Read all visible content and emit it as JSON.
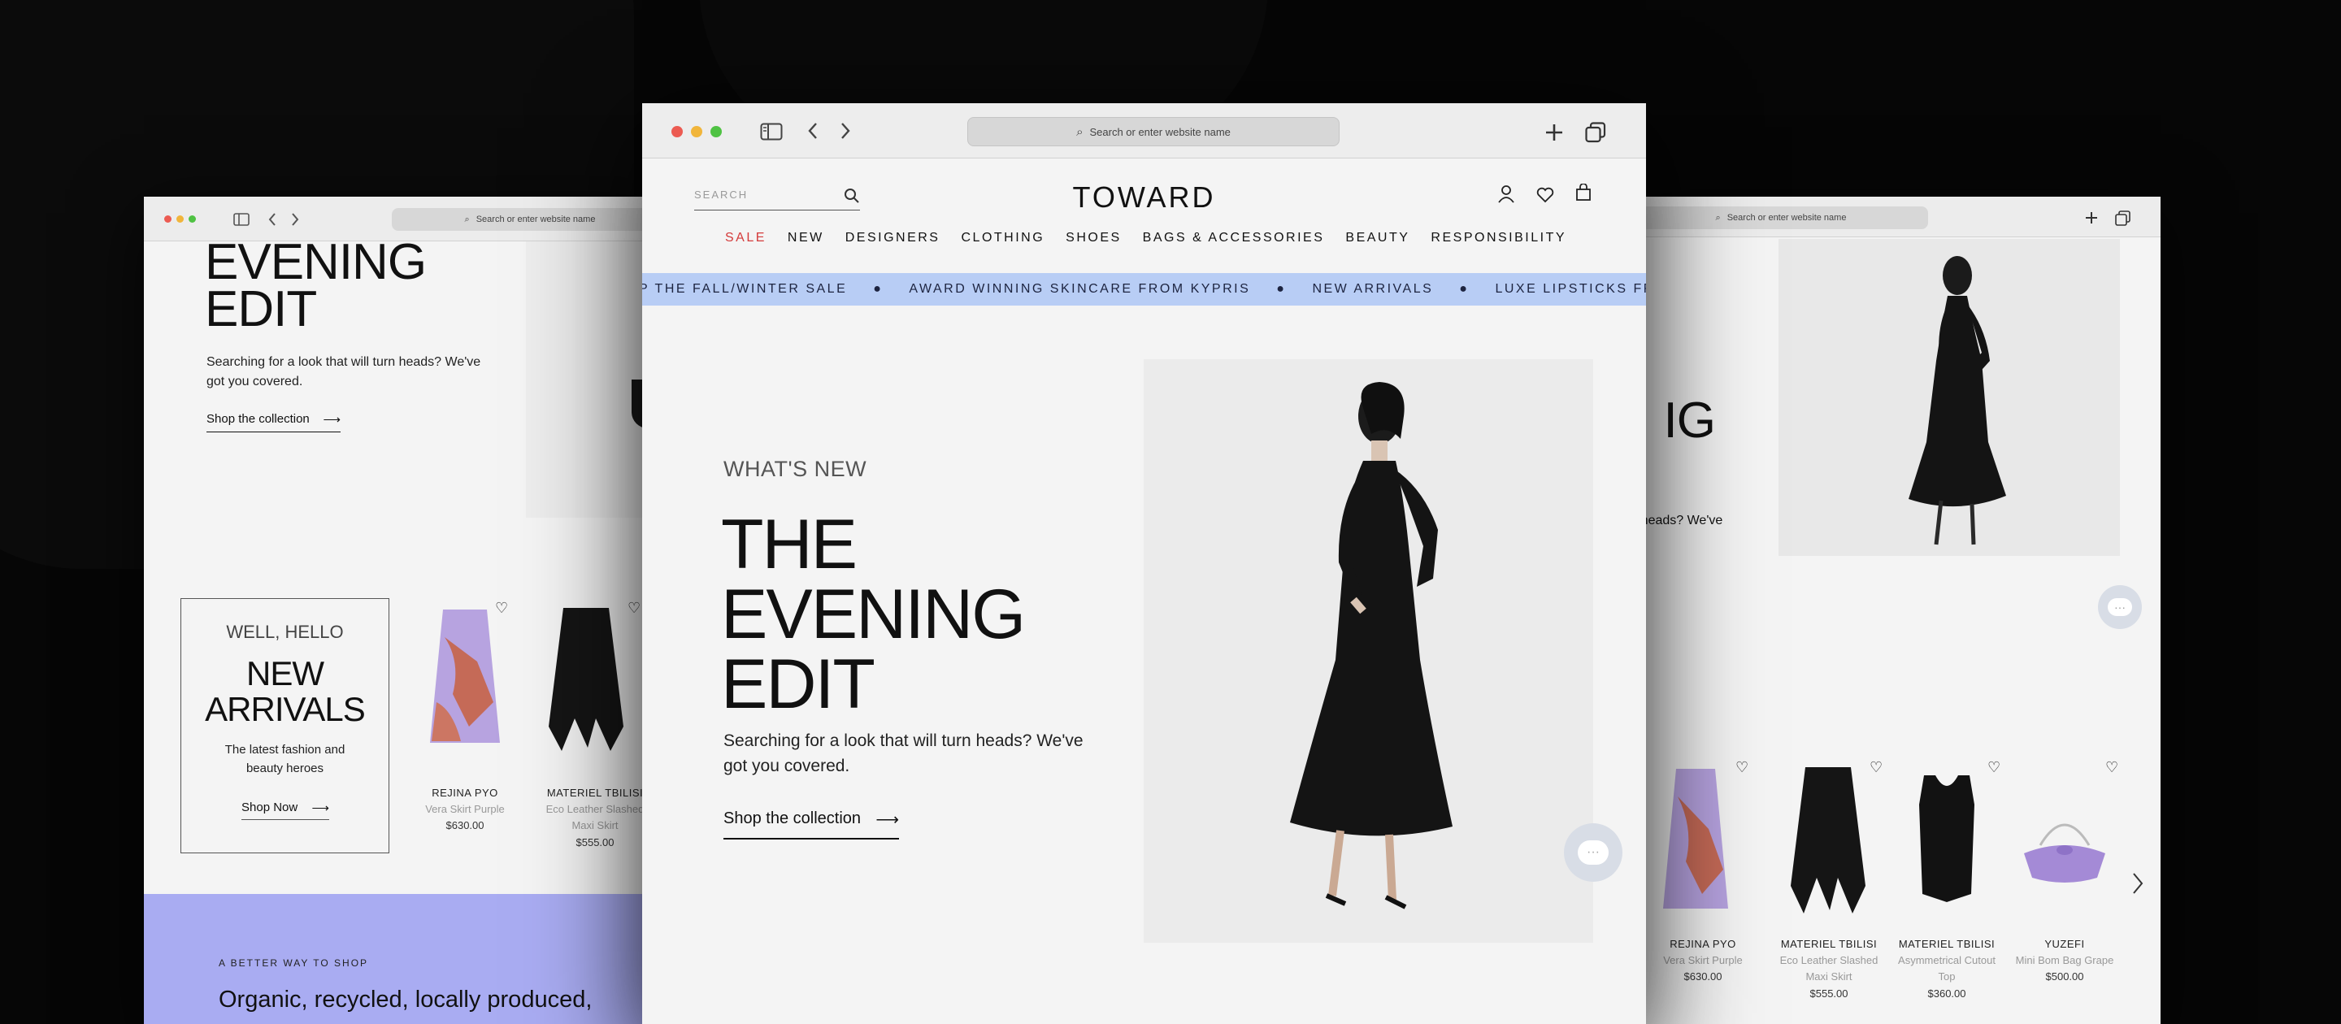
{
  "colors": {
    "bg": "#060606",
    "accent_sale": "#d43b3b",
    "ticker_bg": "#b8cdf5",
    "promo_bg": "#a9acf2"
  },
  "center": {
    "url_placeholder": "Search or enter website name",
    "search_placeholder": "SEARCH",
    "logo": "TOWARD",
    "nav": [
      "SALE",
      "NEW",
      "DESIGNERS",
      "CLOTHING",
      "SHOES",
      "BAGS & ACCESSORIES",
      "BEAUTY",
      "RESPONSIBILITY"
    ],
    "ticker": [
      "P THE FALL/WINTER SALE",
      "AWARD WINNING SKINCARE FROM KYPRIS",
      "NEW ARRIVALS",
      "LUXE LIPSTICKS FROM LA"
    ],
    "hero": {
      "eyebrow": "WHAT'S NEW",
      "title_lines": [
        "THE",
        "EVENING",
        "EDIT"
      ],
      "subtitle": "Searching for a look that will turn heads? We've got you covered.",
      "cta": "Shop the collection"
    }
  },
  "left": {
    "url_placeholder": "Search or enter website name",
    "hero": {
      "title_lines": [
        "EVENING",
        "EDIT"
      ],
      "subtitle": "Searching for a look that will turn heads? We've got you covered.",
      "cta": "Shop the collection"
    },
    "arrivals": {
      "eyebrow": "WELL, HELLO",
      "title_lines": [
        "NEW",
        "ARRIVALS"
      ],
      "subtitle": "The latest fashion and beauty heroes",
      "cta": "Shop Now"
    },
    "products": [
      {
        "brand": "REJINA PYO",
        "name": "Vera Skirt Purple",
        "price": "$630.00"
      },
      {
        "brand": "MATERIEL TBILISI",
        "name": "Eco Leather Slashed Maxi Skirt",
        "price": "$555.00"
      }
    ],
    "promo": {
      "eyebrow": "A BETTER WAY TO SHOP",
      "text": "Organic, recycled, locally produced,"
    }
  },
  "right": {
    "url_placeholder": "Search or enter website name",
    "hero_fragments": {
      "title_tail": "IG",
      "subtitle_tail": "rn heads? We've"
    },
    "products": [
      {
        "brand": "REJINA PYO",
        "name": "Vera Skirt Purple",
        "price": "$630.00"
      },
      {
        "brand": "MATERIEL TBILISI",
        "name": "Eco Leather Slashed Maxi Skirt",
        "price": "$555.00"
      },
      {
        "brand": "MATERIEL TBILISI",
        "name": "Asymmetrical Cutout Top",
        "price": "$360.00"
      },
      {
        "brand": "YUZEFI",
        "name": "Mini Bom Bag Grape",
        "price": "$500.00"
      }
    ]
  }
}
